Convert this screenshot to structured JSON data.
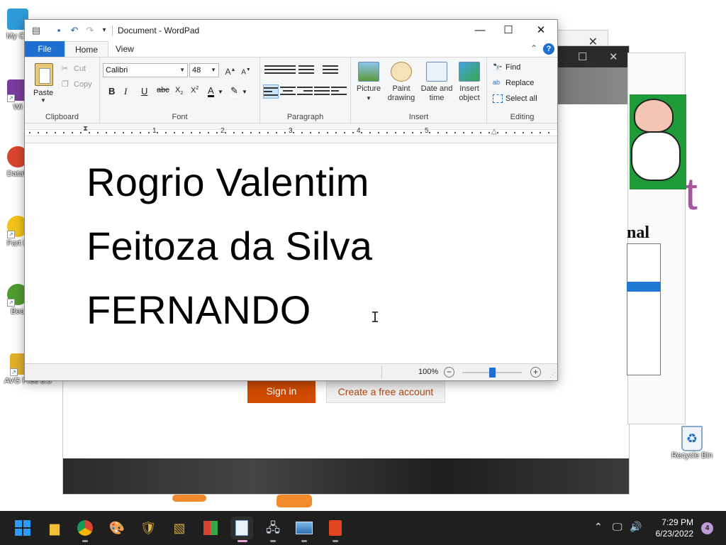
{
  "desktop": {
    "icons": [
      {
        "label": "My Co",
        "icon": "computer-icon",
        "color": "#2e9ad8"
      },
      {
        "label": "Wi",
        "icon": "winrar-icon",
        "color": "#7a3b9c"
      },
      {
        "label": "DataV",
        "icon": "atom-icon",
        "color": "#d8452e"
      },
      {
        "label": "Fart D",
        "icon": "smiley-icon",
        "color": "#f2c21a"
      },
      {
        "label": "Bea",
        "icon": "beans-icon",
        "color": "#4f9b2e"
      },
      {
        "label": "AVG Free 8.5",
        "icon": "avg-icon",
        "color": "#e4b02a"
      }
    ],
    "recycle_bin_label": "Recycle Bin"
  },
  "background": {
    "sign_in_label": "Sign in",
    "create_account_label": "Create a free account",
    "heading_fragment": "nal",
    "big_letter": "t"
  },
  "wordpad": {
    "title": "Document - WordPad",
    "tabs": [
      "File",
      "Home",
      "View"
    ],
    "clipboard": {
      "paste": "Paste",
      "cut": "Cut",
      "copy": "Copy",
      "group_label": "Clipboard"
    },
    "font": {
      "family": "Calibri",
      "size": "48",
      "group_label": "Font"
    },
    "paragraph": {
      "group_label": "Paragraph"
    },
    "insert": {
      "picture": "Picture",
      "paint_drawing_1": "Paint",
      "paint_drawing_2": "drawing",
      "date_time_1": "Date and",
      "date_time_2": "time",
      "insert_object_1": "Insert",
      "insert_object_2": "object",
      "group_label": "Insert"
    },
    "editing": {
      "find": "Find",
      "replace": "Replace",
      "select_all": "Select all",
      "group_label": "Editing"
    },
    "ruler_numbers": [
      "1",
      "2",
      "3",
      "4",
      "5"
    ],
    "document_lines": [
      "Rogrio Valentim",
      "Feitoza da Silva",
      "FERNANDO"
    ],
    "status": {
      "zoom_label": "100%",
      "zoom_fraction": 0.5
    }
  },
  "taskbar": {
    "apps": [
      {
        "icon": "start-icon"
      },
      {
        "icon": "file-explorer-icon"
      },
      {
        "icon": "chrome-icon"
      },
      {
        "icon": "paint-icon"
      },
      {
        "icon": "security-shield-icon"
      },
      {
        "icon": "winrar-icon"
      },
      {
        "icon": "office-tiles-icon"
      },
      {
        "icon": "wordpad-icon"
      },
      {
        "icon": "network-computer-icon"
      },
      {
        "icon": "image-viewer-icon"
      },
      {
        "icon": "office-icon"
      }
    ],
    "time": "7:29 PM",
    "date": "6/23/2022",
    "notification_count": "4"
  },
  "colors": {
    "accent": "#1e6fd0",
    "taskbar": "#1f1f1f",
    "sign_in": "#d04a00"
  }
}
